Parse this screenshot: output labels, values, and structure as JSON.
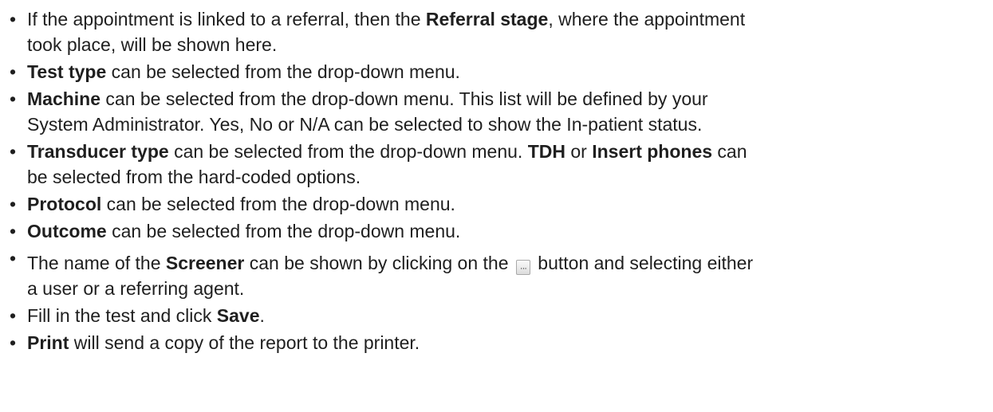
{
  "bullets": [
    {
      "t1": "If the appointment is linked to a referral, then the ",
      "b1": "Referral stage",
      "t2": ", where the appointment",
      "t3": "took place, will be shown here."
    },
    {
      "b1": "Test type",
      "t1": " can be selected from the drop-down menu."
    },
    {
      "b1": "Machine",
      "t1": " can be selected from the drop-down menu. This list will be defined by your",
      "t2": "System Administrator. Yes, No or N/A can be selected to show the In-patient status."
    },
    {
      "b1": "Transducer type",
      "t1": " can be selected from the drop-down menu. ",
      "b2": "TDH",
      "t2": " or ",
      "b3": "Insert phones",
      "t3": " can",
      "t4": "be selected from the hard-coded options."
    },
    {
      "b1": "Protocol",
      "t1": " can be selected from the drop-down menu."
    },
    {
      "b1": "Outcome",
      "t1": " can be selected from the drop-down menu."
    },
    {
      "t1": "The name of the ",
      "b1": "Screener",
      "t2": " can be shown by clicking on the ",
      "t3": " button and selecting either",
      "t4": "a user or a referring agent."
    },
    {
      "t1": "Fill in the test and click ",
      "b1": "Save",
      "t2": "."
    },
    {
      "b1": "Print",
      "t1": " will send a copy of the report to the printer."
    }
  ],
  "bullet_glyph": "•",
  "icons": {
    "ellipsis_button": "ellipsis-button-icon",
    "ellipsis_glyph": "···"
  }
}
